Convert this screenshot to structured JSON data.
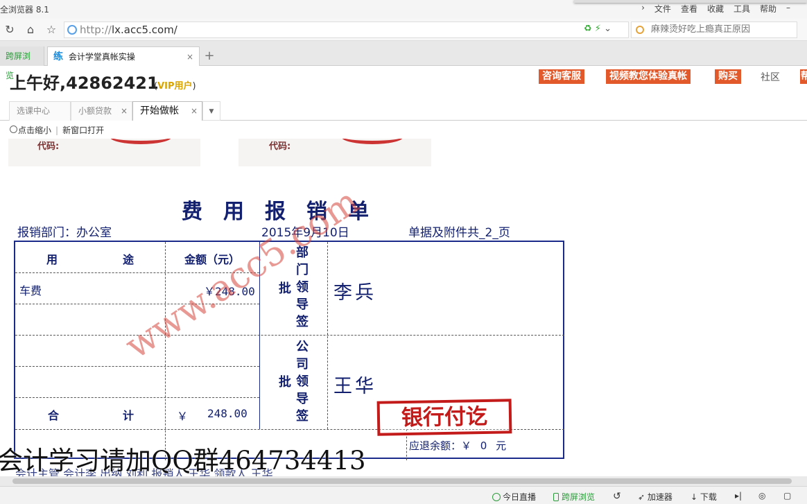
{
  "browser": {
    "app_name": "全浏览器 8.1",
    "menu": [
      "文件",
      "查看",
      "收藏",
      "工具",
      "帮助"
    ],
    "url_scheme": "http://",
    "url_host": "lx.acc5.com/",
    "search_placeholder": "麻辣烫好吃上瘾真正原因",
    "tabs": [
      {
        "label": "跨屏浏览"
      },
      {
        "favicon": "练",
        "label": "会计学堂真帐实操",
        "close": "×"
      }
    ],
    "new_tab": "+"
  },
  "header": {
    "greeting": "上午好,42862421",
    "vip_prefix": "(",
    "vip_label": "VIP用户",
    "vip_suffix": ")",
    "buttons": [
      "咨询客服",
      "视频教您体验真帐",
      "购买",
      "帮"
    ],
    "community": "社区"
  },
  "app_tabs": [
    {
      "label": "选课中心"
    },
    {
      "label": "小额贷款",
      "close": "×"
    },
    {
      "label": "开始做帐",
      "close": "×"
    }
  ],
  "toolbar": {
    "zoom": "点击缩小",
    "new_window": "新窗口打开"
  },
  "document": {
    "stamp_code_label": "代码:",
    "title": "费用报销单",
    "department": "报销部门：办公室",
    "date": "2015年9月10日",
    "attachments": "单据及附件共_2_页",
    "col_usage_1": "用",
    "col_usage_2": "途",
    "col_amount": "金额（元）",
    "rows": [
      {
        "usage": "车费",
        "amount": "￥248.00"
      }
    ],
    "total_1": "合",
    "total_2": "计",
    "total_currency": "￥",
    "total_amount": "248.00",
    "approve_char": "批",
    "dept_leader_chars": [
      "部",
      "门",
      "领",
      "导",
      "签"
    ],
    "company_leader_chars": [
      "公",
      "司",
      "领",
      "导",
      "签"
    ],
    "dept_signature": "李兵",
    "company_signature": "王华",
    "refund_label": "应退余额：￥",
    "refund_value": "0",
    "refund_unit": "元",
    "paid_stamp": "银行付讫",
    "watermark": "www.acc5.com",
    "bottom_partial": "会计主管  会计李    出纳 刘利  报销人 王华  领款人 王华"
  },
  "overlay_caption": "会计学习请加QQ群464734413",
  "statusbar": {
    "items": [
      "今日直播",
      "跨屏浏览",
      "加速器",
      "下载"
    ]
  },
  "colors": {
    "form_blue": "#13206f",
    "stamp_red": "#c31a1a",
    "button_orange": "#e25a2b",
    "vip_gold": "#d9a400"
  }
}
